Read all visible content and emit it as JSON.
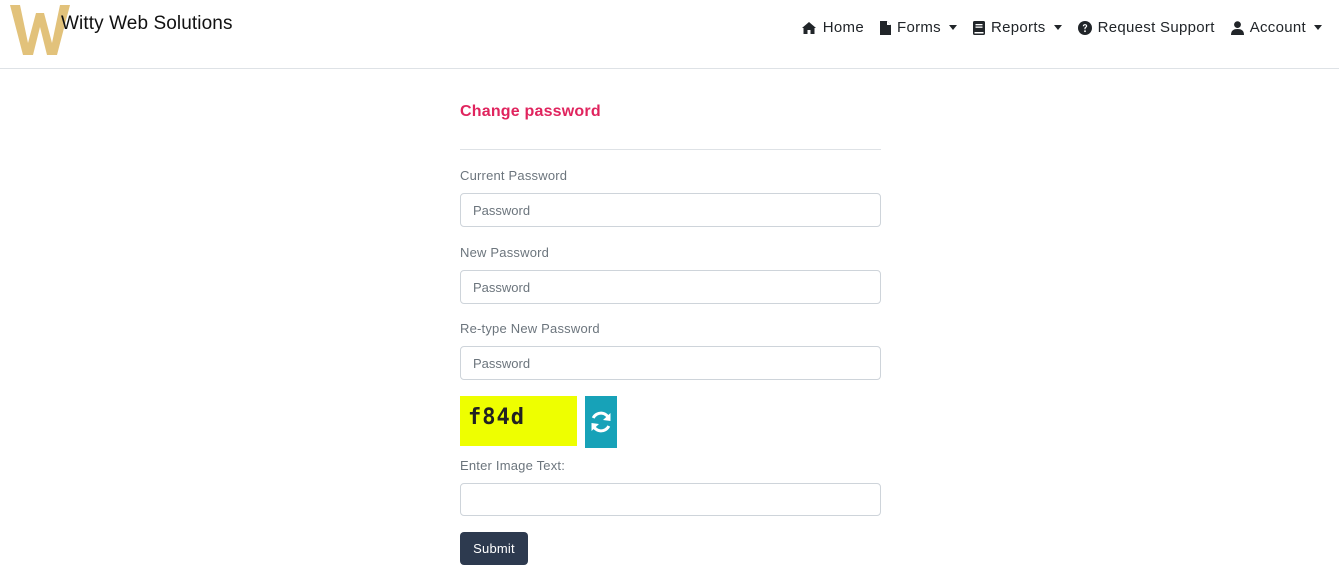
{
  "brand": {
    "name": "Witty Web Solutions",
    "logo_letter": "W",
    "logo_color": "#e2c27b"
  },
  "nav": {
    "items": [
      {
        "label": "Home",
        "icon": "home-icon",
        "dropdown": false
      },
      {
        "label": "Forms",
        "icon": "file-icon",
        "dropdown": true
      },
      {
        "label": "Reports",
        "icon": "book-icon",
        "dropdown": true
      },
      {
        "label": "Request Support",
        "icon": "question-circle-icon",
        "dropdown": false
      },
      {
        "label": "Account",
        "icon": "user-icon",
        "dropdown": true
      }
    ]
  },
  "form": {
    "title": "Change password",
    "title_color": "#e0245e",
    "current_password": {
      "label": "Current Password",
      "placeholder": "Password",
      "value": ""
    },
    "new_password": {
      "label": "New Password",
      "placeholder": "Password",
      "value": ""
    },
    "retype_password": {
      "label": "Re-type New Password",
      "placeholder": "Password",
      "value": ""
    },
    "captcha": {
      "text": "f84d",
      "background": "#eeff00",
      "refresh_icon": "refresh-icon",
      "refresh_color": "#17a2b8"
    },
    "image_text": {
      "label": "Enter Image Text:",
      "placeholder": "",
      "value": ""
    },
    "submit_label": "Submit",
    "submit_color": "#2d3a4f"
  }
}
